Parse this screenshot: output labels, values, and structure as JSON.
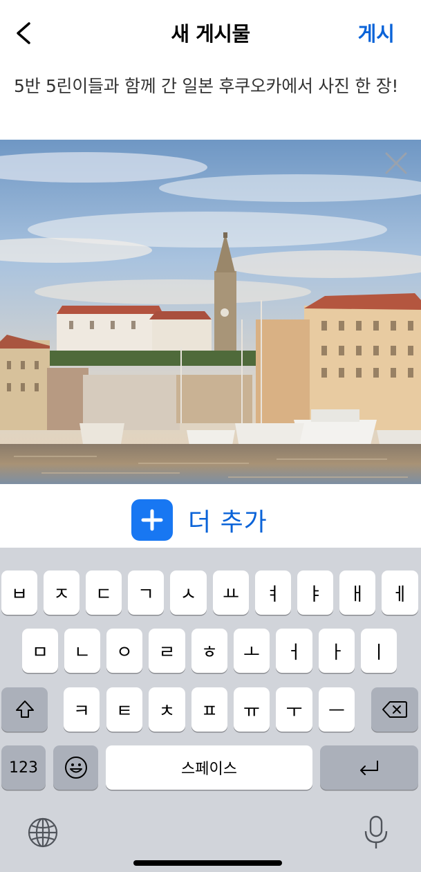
{
  "header": {
    "back_icon": "chevron-left",
    "title": "새 게시물",
    "post_label": "게시"
  },
  "caption": "5반 5린이들과 함께 간 일본 후쿠오카에서 사진 한 장!",
  "photo": {
    "remove_icon": "close",
    "description_icon": "harbor-photo"
  },
  "add_more": {
    "icon": "plus",
    "label": "더 추가"
  },
  "keyboard": {
    "row1": [
      "ㅂ",
      "ㅈ",
      "ㄷ",
      "ㄱ",
      "ㅅ",
      "ㅛ",
      "ㅕ",
      "ㅑ",
      "ㅐ",
      "ㅔ"
    ],
    "row2": [
      "ㅁ",
      "ㄴ",
      "ㅇ",
      "ㄹ",
      "ㅎ",
      "ㅗ",
      "ㅓ",
      "ㅏ",
      "ㅣ"
    ],
    "row3": [
      "ㅋ",
      "ㅌ",
      "ㅊ",
      "ㅍ",
      "ㅠ",
      "ㅜ",
      "ㅡ"
    ],
    "numbers_label": "123",
    "space_label": "스페이스",
    "shift_icon": "shift",
    "delete_icon": "backspace",
    "emoji_icon": "emoji",
    "return_icon": "return",
    "globe_icon": "globe",
    "mic_icon": "microphone"
  },
  "colors": {
    "accent": "#0a63d8",
    "add_button": "#1877f2",
    "keyboard_bg": "#d1d4da",
    "special_key": "#abb0ba"
  }
}
